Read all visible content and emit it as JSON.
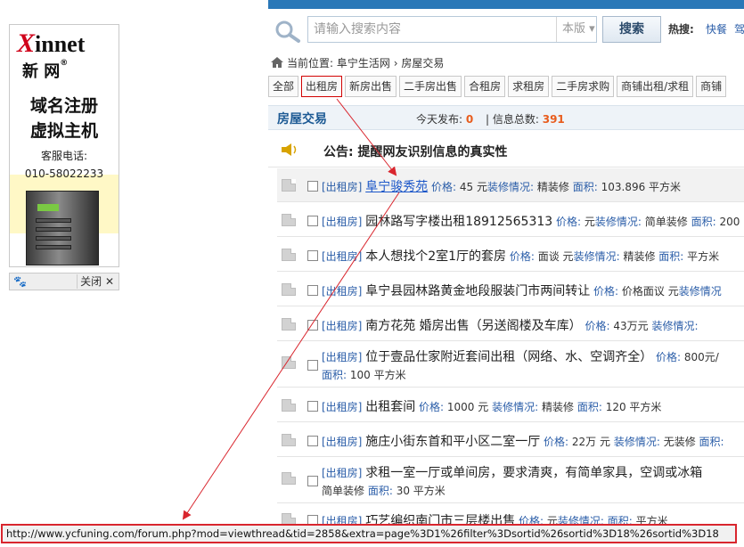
{
  "ad": {
    "brand_latin": "innet",
    "brand_x": "X",
    "brand_cn": "新 网",
    "reg": "®",
    "line1": "域名注册",
    "line2": "虚拟主机",
    "tel_label": "客服电话:",
    "tel": "010-58022233",
    "close_label": "关闭 ✕",
    "paw": "🐾"
  },
  "search": {
    "placeholder": "请输入搜索内容",
    "scope": "本版 ▾",
    "button": "搜索",
    "hot_label": "热搜:",
    "hot": [
      "快餐",
      "驾"
    ]
  },
  "breadcrumb": {
    "prefix": "当前位置:",
    "site": "阜宁生活网",
    "sep": "›",
    "page": "房屋交易"
  },
  "tabs": [
    "全部",
    "出租房",
    "新房出售",
    "二手房出售",
    "合租房",
    "求租房",
    "二手房求购",
    "商铺出租/求租",
    "商铺"
  ],
  "section": {
    "title": "房屋交易",
    "today_label": "今天发布:",
    "today_value": "0",
    "total_label": "信息总数:",
    "total_value": "391"
  },
  "notice": {
    "text": "公告: 提醒网友识别信息的真实性"
  },
  "listings": [
    {
      "tag": "[出租房]",
      "title": "阜宁骏秀苑",
      "price_label": "价格:",
      "price": "45 元",
      "deco_label": "装修情况:",
      "deco": "精装修",
      "area_label": "面积:",
      "area": "103.896 平方米"
    },
    {
      "tag": "[出租房]",
      "title": "园林路写字楼出租18912565313",
      "price_label": "价格:",
      "price": "元",
      "deco_label": "装修情况:",
      "deco": "简单装修",
      "area_label": "面积:",
      "area": "200"
    },
    {
      "tag": "[出租房]",
      "title": "本人想找个2室1厅的套房",
      "price_label": "价格:",
      "price": "面谈 元",
      "deco_label": "装修情况:",
      "deco": "精装修",
      "area_label": "面积:",
      "area": "平方米"
    },
    {
      "tag": "[出租房]",
      "title": "阜宁县园林路黄金地段服装门市两间转让",
      "price_label": "价格:",
      "price": "价格面议 元",
      "deco_label": "装修情况",
      "deco": "",
      "area_label": "",
      "area": ""
    },
    {
      "tag": "[出租房]",
      "title": "南方花苑  婚房出售（另送阁楼及车库）",
      "price_label": "价格:",
      "price": "43万元",
      "deco_label": "装修情况:",
      "deco": "",
      "area_label": "",
      "area": ""
    },
    {
      "tag": "[出租房]",
      "title": "位于壹品仕家附近套间出租（网络、水、空调齐全）",
      "price_label": "价格:",
      "price": "800元/",
      "deco_label": "",
      "deco": "",
      "area_label": "面积:",
      "area": "100 平方米"
    },
    {
      "tag": "[出租房]",
      "title": "出租套间",
      "price_label": "价格:",
      "price": "1000 元",
      "deco_label": "装修情况:",
      "deco": "精装修",
      "area_label": "面积:",
      "area": "120 平方米"
    },
    {
      "tag": "[出租房]",
      "title": "施庄小街东首和平小区二室一厅",
      "price_label": "价格:",
      "price": "22万 元",
      "deco_label": "装修情况:",
      "deco": "无装修",
      "area_label": "面积:",
      "area": ""
    },
    {
      "tag": "[出租房]",
      "title": "求租一室一厅或单间房，要求清爽，有简单家具，空调或冰箱",
      "price_label": "",
      "price": "",
      "deco_label": "",
      "deco": "简单装修",
      "area_label": "面积:",
      "area": "30 平方米"
    },
    {
      "tag": "[出租房]",
      "title": "巧艺编织南门市三层楼出售",
      "price_label": "价格:",
      "price": "元",
      "deco_label": "装修情况:",
      "deco": "",
      "area_label": "面积:",
      "area": "平方米"
    }
  ],
  "status_url": "http://www.ycfuning.com/forum.php?mod=viewthread&tid=2858&extra=page%3D1%26filter%3Dsortid%26sortid%3D18%26sortid%3D18",
  "colors": {
    "accent": "#2a5da8",
    "highlight_border": "#d00000",
    "count_number": "#e85c1d",
    "annotation_arrow": "#d9262e"
  }
}
